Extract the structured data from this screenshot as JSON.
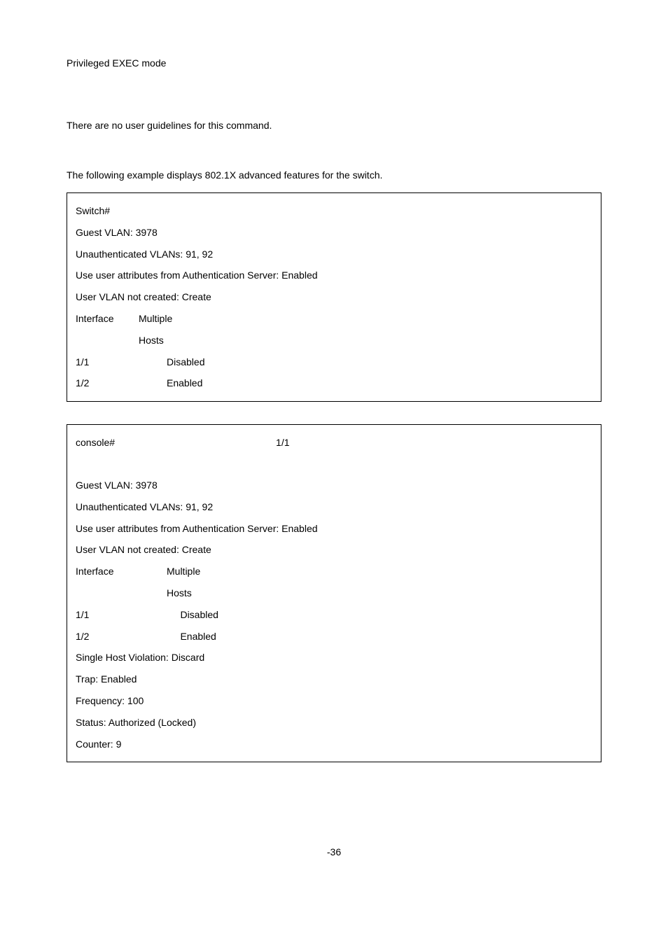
{
  "top": {
    "mode": "Privileged EXEC mode",
    "guidelines": "There are no user guidelines for this command.",
    "intro": "The following example displays 802.1X advanced features for the switch."
  },
  "box1": {
    "prompt": "Switch#",
    "l1": "Guest VLAN: 3978",
    "l2": "Unauthenticated VLANs: 91, 92",
    "l3": "Use user attributes from Authentication Server: Enabled",
    "l4": "User VLAN not created: Create",
    "hdr_iface": "Interface",
    "hdr_multiple": "Multiple",
    "hdr_hosts": "Hosts",
    "r1_iface": "1/1",
    "r1_val": "Disabled",
    "r2_iface": "1/2",
    "r2_val": "Enabled"
  },
  "box2": {
    "prompt": "console#",
    "prompt_arg": "1/1",
    "l1": "Guest VLAN: 3978",
    "l2": "Unauthenticated VLANs: 91, 92",
    "l3": "Use user attributes from Authentication Server: Enabled",
    "l4": "User VLAN not created: Create",
    "hdr_iface": "Interface",
    "hdr_multiple": "Multiple",
    "hdr_hosts": "Hosts",
    "r1_iface": "1/1",
    "r1_val": "Disabled",
    "r2_iface": "1/2",
    "r2_val": "Enabled",
    "l5": "Single Host Violation: Discard",
    "l6": "Trap: Enabled",
    "l7": "Frequency: 100",
    "l8": "Status: Authorized (Locked)",
    "l9": "Counter: 9"
  },
  "footer": "-36"
}
